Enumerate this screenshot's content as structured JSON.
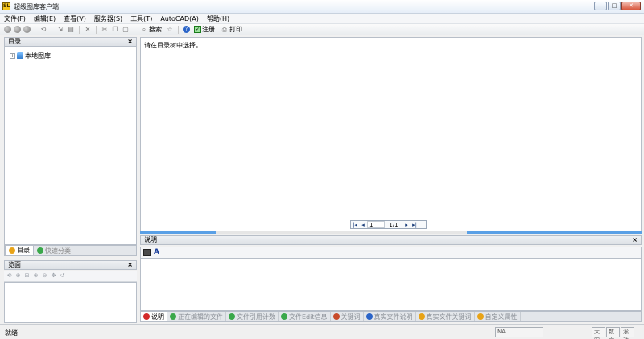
{
  "window": {
    "title": "超级图库客户端",
    "icon_text": "SL",
    "btn_minimize": "–",
    "btn_maximize": "□",
    "btn_close": "✕"
  },
  "menu": [
    "文件(F)",
    "编辑(E)",
    "查看(V)",
    "服务器(S)",
    "工具(T)",
    "AutoCAD(A)",
    "帮助(H)"
  ],
  "toolbar": {
    "search_label": "搜索",
    "register_label": "注册",
    "print_label": "打印",
    "help_glyph": "?"
  },
  "directory_panel": {
    "title": "目录",
    "close": "×",
    "tree_expander": "+",
    "tree_root": "本地图库"
  },
  "left_tabs": [
    {
      "label": "目录",
      "active": true,
      "color": "#e8a317"
    },
    {
      "label": "快速分类",
      "active": false,
      "color": "#3aa84a"
    }
  ],
  "view_panel": {
    "title": "览面",
    "close": "×"
  },
  "main": {
    "message": "请在目录树中选择。",
    "pager": {
      "first": "|◂",
      "prev": "◂",
      "current": "1",
      "total": "1/1",
      "next": "▸",
      "last": "▸|"
    }
  },
  "description_panel": {
    "title": "说明",
    "close": "×",
    "font_icon": "A"
  },
  "bottom_tabs": [
    {
      "label": "说明",
      "active": true,
      "color": "#d32a2a"
    },
    {
      "label": "正在编辑的文件",
      "active": false,
      "color": "#3aa84a"
    },
    {
      "label": "文件引用计数",
      "active": false,
      "color": "#3aa84a"
    },
    {
      "label": "文件Edit信息",
      "active": false,
      "color": "#3aa84a"
    },
    {
      "label": "关键词",
      "active": false,
      "color": "#c84a2a"
    },
    {
      "label": "真实文件说明",
      "active": false,
      "color": "#2a64c8"
    },
    {
      "label": "真实文件关键词",
      "active": false,
      "color": "#e8a317"
    },
    {
      "label": "自定义属性",
      "active": false,
      "color": "#e8a317"
    }
  ],
  "status": {
    "left": "就绪",
    "field": "NA",
    "caps": "大写",
    "num": "数字",
    "scroll": "滚动"
  }
}
